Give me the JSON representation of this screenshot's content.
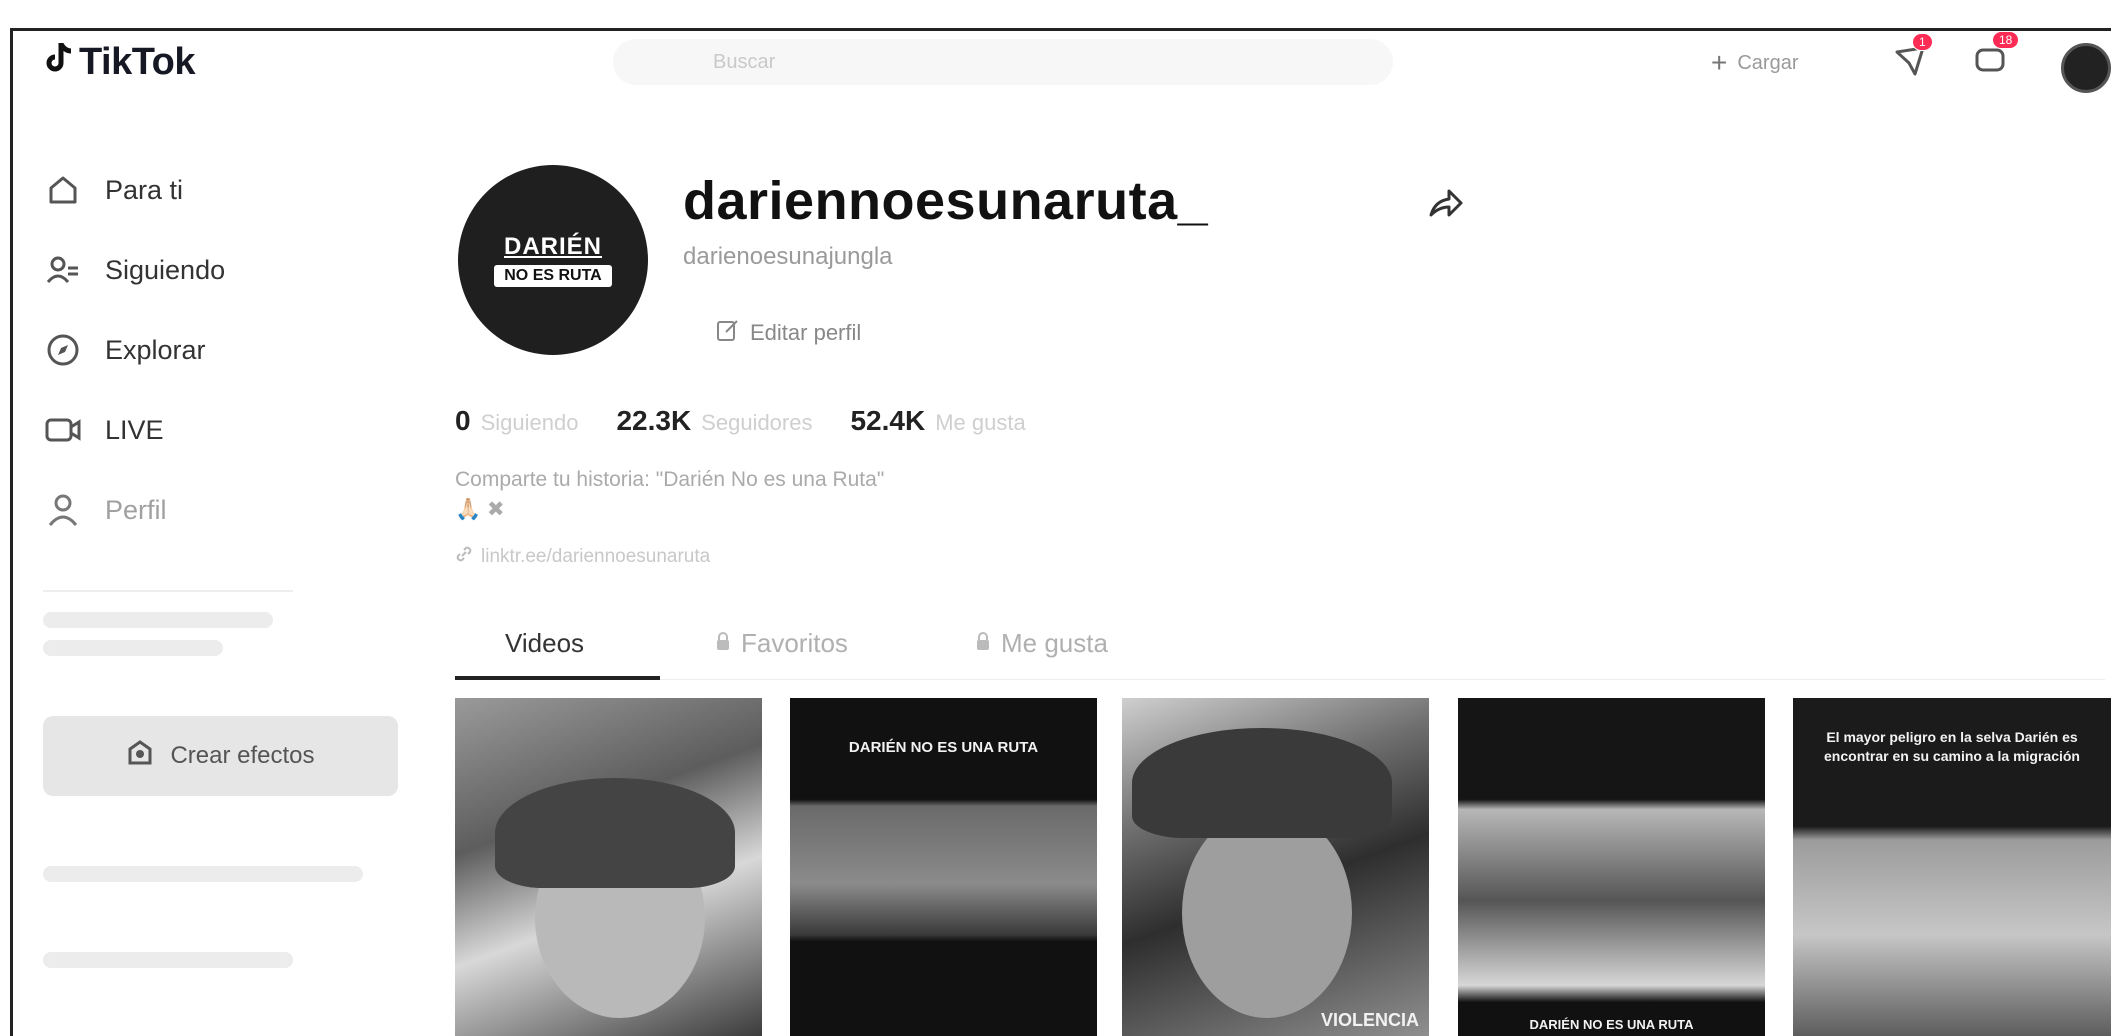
{
  "header": {
    "logo_text": "TikTok",
    "search_placeholder": "Buscar",
    "upload_label": "Cargar",
    "inbox_badge": "1",
    "messages_badge": "18"
  },
  "sidebar": {
    "items": [
      {
        "label": "Para ti",
        "icon": "home-icon"
      },
      {
        "label": "Siguiendo",
        "icon": "following-icon"
      },
      {
        "label": "Explorar",
        "icon": "compass-icon"
      },
      {
        "label": "LIVE",
        "icon": "live-icon"
      },
      {
        "label": "Perfil",
        "icon": "profile-icon"
      }
    ],
    "effects_label": "Crear efectos"
  },
  "profile": {
    "username": "dariennoesunaruta_",
    "nickname": "darienoesunajungla",
    "edit_label": "Editar perfil",
    "avatar_text_top": "DARIÉN",
    "avatar_text_mid": "NO ES RUTA",
    "stats": [
      {
        "num": "0",
        "label": "Siguiendo"
      },
      {
        "num": "22.3K",
        "label": "Seguidores"
      },
      {
        "num": "52.4K",
        "label": "Me gusta"
      }
    ],
    "bio_line1": "Comparte tu historia: \"Darién No es una Ruta\"",
    "bio_line2": "🙏🏻 ✖",
    "bio_link": "linktr.ee/dariennoesunaruta"
  },
  "tabs": {
    "videos": "Videos",
    "favorites": "Favoritos",
    "liked": "Me gusta"
  },
  "videos": [
    {
      "caption": ""
    },
    {
      "caption": "DARIÉN NO ES UNA RUTA"
    },
    {
      "caption": "VIOLENCIA"
    },
    {
      "caption": "DARIÉN NO ES UNA RUTA"
    },
    {
      "caption": "El mayor peligro en la selva Darién es encontrar en su camino a la migración"
    }
  ]
}
